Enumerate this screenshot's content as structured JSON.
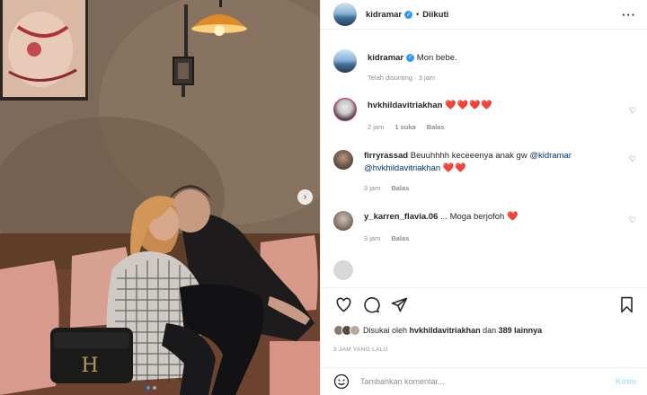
{
  "header": {
    "username": "kidramar",
    "separator": "•",
    "follow_status": "Diikuti",
    "more_icon": "ellipsis-icon"
  },
  "caption": {
    "username": "kidramar",
    "text": "Mon bebe.",
    "edited_meta": "Telah disunting · 3 jam"
  },
  "comments": [
    {
      "username": "hvkhildavitriakhan",
      "text_parts": [],
      "hearts": "❤️❤️❤️❤️",
      "time": "2 jam",
      "likes": "1 suka",
      "reply": "Balas"
    },
    {
      "username": "firryrassad",
      "text": "Beuuhhhh keceeenya anak gw",
      "mention1": "@kidramar",
      "mention2": "@hvkhildavitriakhan",
      "hearts": "❤️❤️",
      "time": "3 jam",
      "reply": "Balas"
    },
    {
      "username": "y_karren_flavia.06",
      "text": "... Moga berjofoh",
      "hearts": "❤️",
      "time": "3 jam",
      "reply": "Balas"
    }
  ],
  "actions": {
    "like_icon": "heart-icon",
    "comment_icon": "comment-icon",
    "share_icon": "paper-plane-icon",
    "save_icon": "bookmark-icon"
  },
  "likes": {
    "prefix": "Disukai oleh",
    "user": "hvkhildavitriakhan",
    "middle": "dan",
    "others": "389 lainnya"
  },
  "timestamp": "3 JAM YANG LALU",
  "composer": {
    "placeholder": "Tambahkan komentar...",
    "send_label": "Kirim"
  },
  "carousel": {
    "slide_count": 2,
    "active_index": 0
  },
  "colors": {
    "accent": "#3897f0",
    "heart": "#ed4956",
    "send_disabled": "#b2dffc"
  }
}
